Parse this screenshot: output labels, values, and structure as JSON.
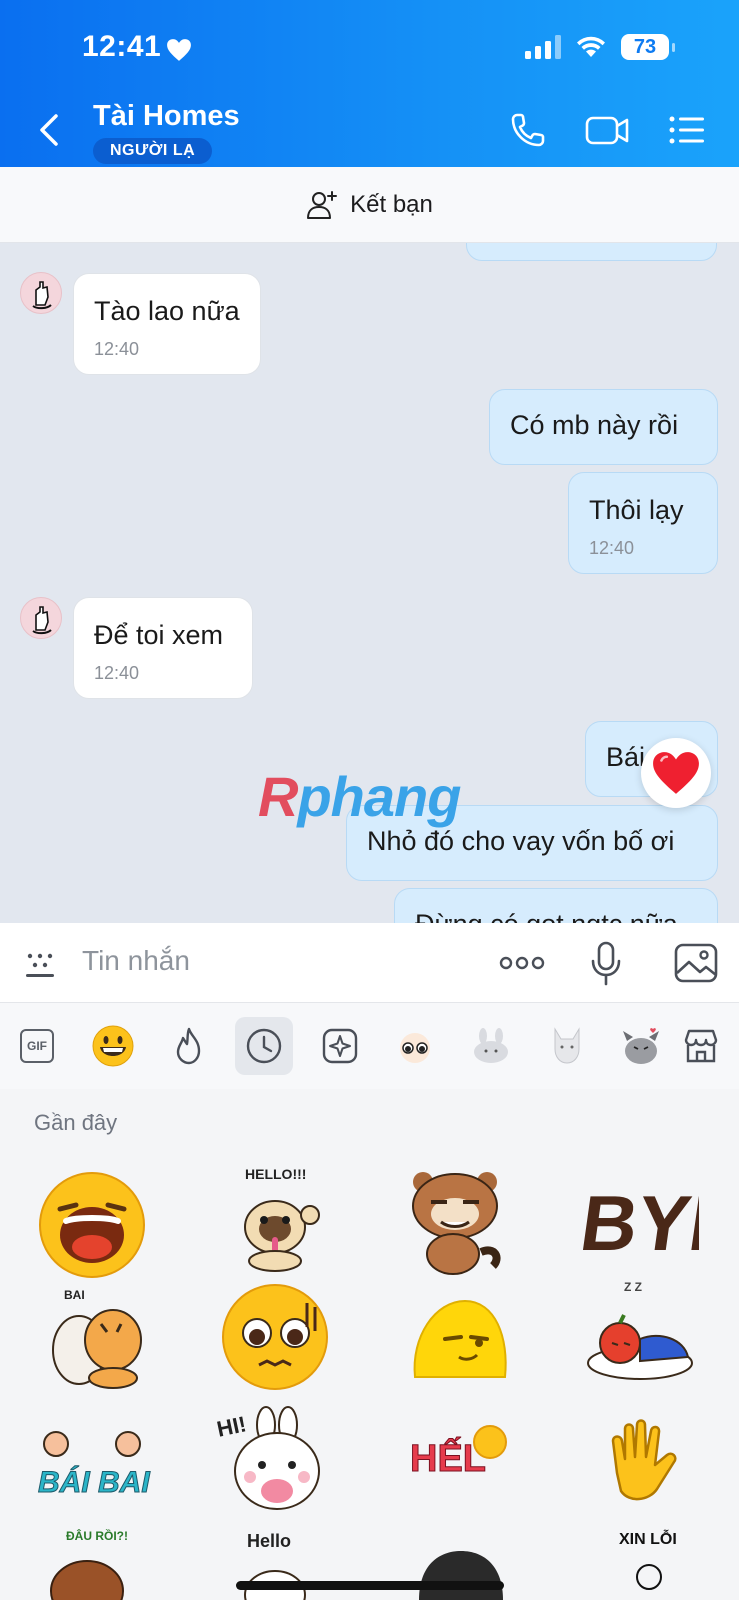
{
  "status_bar": {
    "time": "12:41",
    "battery": "73"
  },
  "header": {
    "contact_name": "Tài Homes",
    "badge": "NGƯỜI LẠ"
  },
  "friend_bar": {
    "label": "Kết bạn"
  },
  "messages": [
    {
      "text": "Tào lao nữa",
      "time": "12:40",
      "dir": "in"
    },
    {
      "text": "Có mb này rồi",
      "time": "",
      "dir": "out"
    },
    {
      "text": "Thôi lạy",
      "time": "12:40",
      "dir": "out"
    },
    {
      "text": "Để toi xem",
      "time": "12:40",
      "dir": "in"
    },
    {
      "text": "Bái",
      "time": "",
      "dir": "out"
    },
    {
      "text": "Nhỏ đó cho vay vốn bố ơi",
      "time": "",
      "dir": "out"
    },
    {
      "text": "Đừng có got ngtc nữa",
      "time": "",
      "dir": "out"
    }
  ],
  "watermark": {
    "part1": "R",
    "part2": "phang"
  },
  "input": {
    "placeholder": "Tin nhắn"
  },
  "sticker_tabs": {
    "gif_label": "GIF"
  },
  "sticker_panel": {
    "section_label": "Gần đây"
  },
  "stickers": [
    {
      "name": "laughing-face-sticker",
      "text": ""
    },
    {
      "name": "pug-hello-sticker",
      "text": "HELLO!!!"
    },
    {
      "name": "raccoon-smirk-sticker",
      "text": ""
    },
    {
      "name": "bye-sticker",
      "text": "BYE"
    },
    {
      "name": "tiger-hug-sticker",
      "text": "BAI"
    },
    {
      "name": "worried-face-sticker",
      "text": ""
    },
    {
      "name": "yellow-chick-sticker",
      "text": ""
    },
    {
      "name": "sleeping-apple-sticker",
      "text": "Z Z"
    },
    {
      "name": "bai-bai-sticker",
      "text": "BÁI BAI"
    },
    {
      "name": "bunny-hi-sticker",
      "text": "HI!"
    },
    {
      "name": "helo-sticker",
      "text": "HẾL"
    },
    {
      "name": "waving-hand-sticker",
      "text": ""
    },
    {
      "name": "dau-roi-sticker",
      "text": "ĐÂU RỒI?!"
    },
    {
      "name": "hello-small-sticker",
      "text": "Hello"
    },
    {
      "name": "dark-hair-sticker",
      "text": ""
    },
    {
      "name": "xin-loi-sticker",
      "text": "XIN LỖI"
    }
  ],
  "colors": {
    "header_start": "#0a6ff0",
    "header_end": "#1aa3fb",
    "bubble_out": "#d6ecfd",
    "chat_bg": "#e2e7ef"
  }
}
